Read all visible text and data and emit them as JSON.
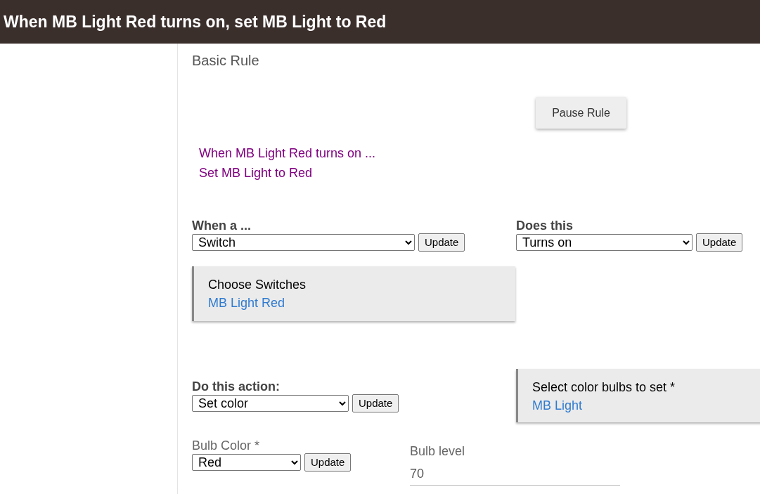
{
  "header": {
    "title": "When MB Light Red turns on, set MB Light to Red"
  },
  "page_title": "Basic Rule",
  "pause_button": "Pause Rule",
  "summary": [
    "When MB Light Red turns on ...",
    "Set MB Light to Red"
  ],
  "trigger": {
    "label": "When a ...",
    "value": "Switch",
    "button": "Update"
  },
  "event": {
    "label": "Does this",
    "value": "Turns on",
    "button": "Update"
  },
  "device_picker": {
    "label": "Choose Switches",
    "value": "MB Light Red"
  },
  "action": {
    "label": "Do this action:",
    "value": "Set color",
    "button": "Update"
  },
  "bulbs_picker": {
    "label": "Select color bulbs to set *",
    "value": "MB Light"
  },
  "bulb_color": {
    "label": "Bulb Color *",
    "value": "Red",
    "button": "Update"
  },
  "bulb_level": {
    "label": "Bulb level",
    "value": "70"
  }
}
